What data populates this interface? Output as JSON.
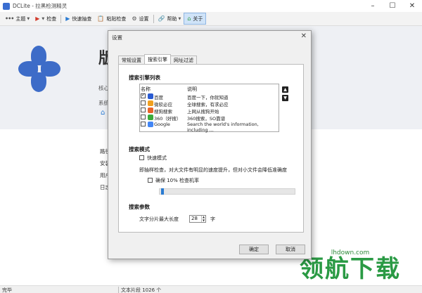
{
  "window": {
    "title": "DCLite - 拉黑检测精灵"
  },
  "toolbar": {
    "theme_label": "主题",
    "check_label": "检查",
    "quick_check_label": "快速抽查",
    "paste_check_label": "粘贴检查",
    "settings_label": "设置",
    "help_label": "帮助",
    "about_label": "关于"
  },
  "main": {
    "big_title": "版",
    "side_lines": [
      "核心",
      "系统"
    ],
    "lower_lines": [
      "路径",
      "安装",
      "用户",
      "日志"
    ]
  },
  "dialog": {
    "title": "设置",
    "tabs": [
      {
        "label": "常规设置"
      },
      {
        "label": "搜索引擎"
      },
      {
        "label": "网址过滤"
      }
    ],
    "engine_section_title": "搜索引擎列表",
    "list_headers": {
      "name": "名称",
      "desc": "说明"
    },
    "engines": [
      {
        "name": "百度",
        "desc": "百度一下，你就知道",
        "checked": true,
        "color": "#2a5bd2"
      },
      {
        "name": "微软必应",
        "desc": "全球搜索，有求必应",
        "checked": false,
        "color": "#f0a020"
      },
      {
        "name": "搜狗搜索",
        "desc": "上网从搜狗开始",
        "checked": false,
        "color": "#e8632a"
      },
      {
        "name": "360（好搜）",
        "desc": "360搜索，SO靠谱",
        "checked": false,
        "color": "#3aaa3a"
      },
      {
        "name": "Google",
        "desc": "Search the world's information, including ...",
        "checked": false,
        "color": "#4285f4"
      }
    ],
    "mode_section_title": "搜索模式",
    "fast_mode_label": "快速模式",
    "fast_mode_checked": false,
    "fast_mode_desc": "即抽样检查，对大文件有明显的速度提升，但对小文件会降低准确度",
    "accuracy_label": "确保 10% 检查机率",
    "accuracy_checked": false,
    "accuracy_fraction": 0.01,
    "params_section_title": "搜索参数",
    "min_len_label": "文字分片最大长度",
    "min_len_value": "28",
    "min_len_unit": "字",
    "ok_label": "确定",
    "cancel_label": "取消"
  },
  "status": {
    "left": "完毕",
    "middle": "文本片段 1026 个"
  },
  "watermark": {
    "url": "lhdown.com",
    "text": "领航下载"
  }
}
